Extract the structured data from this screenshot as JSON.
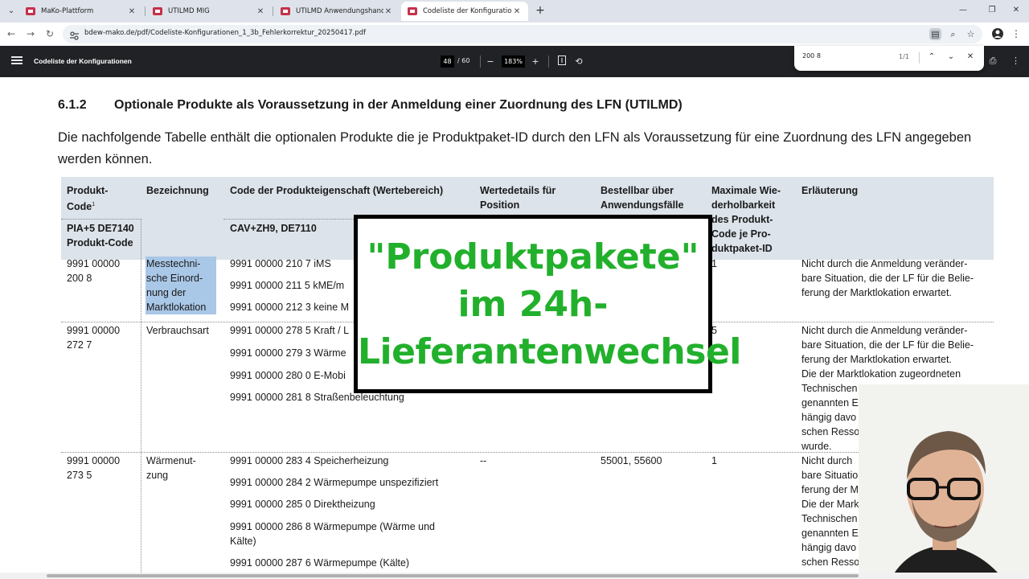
{
  "browser": {
    "tabs": [
      {
        "title": "MaKo-Plattform",
        "active": false
      },
      {
        "title": "UTILMD MIG",
        "active": false
      },
      {
        "title": "UTILMD Anwendungshandbuch",
        "active": false
      },
      {
        "title": "Codeliste der Konfigurationen",
        "active": true
      }
    ],
    "url": "bdew-mako.de/pdf/Codeliste-Konfigurationen_1_3b_Fehlerkorrektur_20250417.pdf"
  },
  "pdf_viewer": {
    "title": "Codeliste der Konfigurationen",
    "current_page": "48",
    "total_pages": "/ 60",
    "zoom": "183%"
  },
  "find_bar": {
    "query": "200 8",
    "result_count": "1/1"
  },
  "document": {
    "section_number": "6.1.2",
    "section_title": "Optionale Produkte als Voraussetzung in der Anmeldung einer Zuordnung des LFN (UTILMD)",
    "intro": "Die nachfolgende Tabelle enthält die optionalen Produkte die je Produktpaket-ID durch den LFN als Voraussetzung für eine Zuordnung des LFN angegeben werden können.",
    "table": {
      "headers": {
        "produkt_code_line1": "Produkt-",
        "produkt_code_line2": "Code",
        "produkt_code_sup": "1",
        "produkt_code_sub1": "PIA+5 DE7140",
        "produkt_code_sub2": "Produkt-Code",
        "bezeichnung": "Bezeichnung",
        "code_eigenschaft": "Code der Produkteigenschaft (Wertebereich)",
        "code_eigenschaft_sub": "CAV+ZH9, DE7110",
        "wertedetails_line1": "Wertedetails für",
        "wertedetails_line2": "Position",
        "bestellbar_line1": "Bestellbar über",
        "bestellbar_line2": "Anwendungsfälle",
        "maximale_line1": "Maximale Wie-",
        "maximale_line2": "derholbarkeit",
        "maximale_line3": "des Produkt-",
        "maximale_line4": "Code je Pro-",
        "maximale_line5": "duktpaket-ID",
        "erlaeuterung": "Erläuterung"
      },
      "rows": [
        {
          "code_line1": "9991 00000",
          "code_line2": "200 8",
          "bezeichnung_lines": [
            "Messtechni-",
            "sche Einord-",
            "nung der",
            "Marktlokation"
          ],
          "eigenschaften": [
            "9991 00000 210 7 iMS",
            "9991 00000 211 5 kME/m",
            "9991 00000 212 3 keine M"
          ],
          "max": "1",
          "erlaeuterung_lines": [
            "Nicht durch die Anmeldung veränder-",
            "bare Situation, die der LF für die Belie-",
            "ferung der Marktlokation erwartet."
          ]
        },
        {
          "code_line1": "9991 00000",
          "code_line2": "272 7",
          "bezeichnung_lines": [
            "Verbrauchsart"
          ],
          "eigenschaften": [
            "9991 00000 278 5 Kraft / L",
            "9991 00000 279 3 Wärme",
            "9991 00000 280 0 E-Mobi",
            "9991 00000 281 8 Straßenbeleuchtung"
          ],
          "max": "5",
          "erlaeuterung_lines": [
            "Nicht durch die Anmeldung veränder-",
            "bare Situation, die der LF für die Belie-",
            "ferung der Marktlokation erwartet.",
            "Die der Marktlokation zugeordneten",
            "Technischen",
            "genannten E",
            "hängig davo",
            "schen Resso",
            "wurde."
          ]
        },
        {
          "code_line1": "9991 00000",
          "code_line2": "273 5",
          "bezeichnung_lines": [
            "Wärmenut-",
            "zung"
          ],
          "eigenschaften": [
            "9991 00000 283 4 Speicherheizung",
            "9991 00000 284 2 Wärmepumpe unspezifiziert",
            "9991 00000 285 0 Direktheizung",
            "9991 00000 286 8 Wärmepumpe (Wärme und",
            "Kälte)",
            "9991 00000 287 6 Wärmepumpe (Kälte)"
          ],
          "wertedetails": "--",
          "bestellbar": "55001, 55600",
          "max": "1",
          "erlaeuterung_lines": [
            "Nicht durch",
            "bare Situatio",
            "ferung der M",
            "Die der Mark",
            "Technischen",
            "genannten E",
            "hängig davo",
            "schen Resso"
          ]
        }
      ]
    }
  },
  "overlay": {
    "line1": "\"Produktpakete\"",
    "line2": "im 24h-",
    "line3": "Lieferantenwechsel"
  },
  "colors": {
    "overlay_text": "#22b02c",
    "table_header_bg": "#dce3ea",
    "highlight": "#a9c7e6",
    "pdf_toolbar": "#202225",
    "tabstrip": "#dee3eb"
  }
}
